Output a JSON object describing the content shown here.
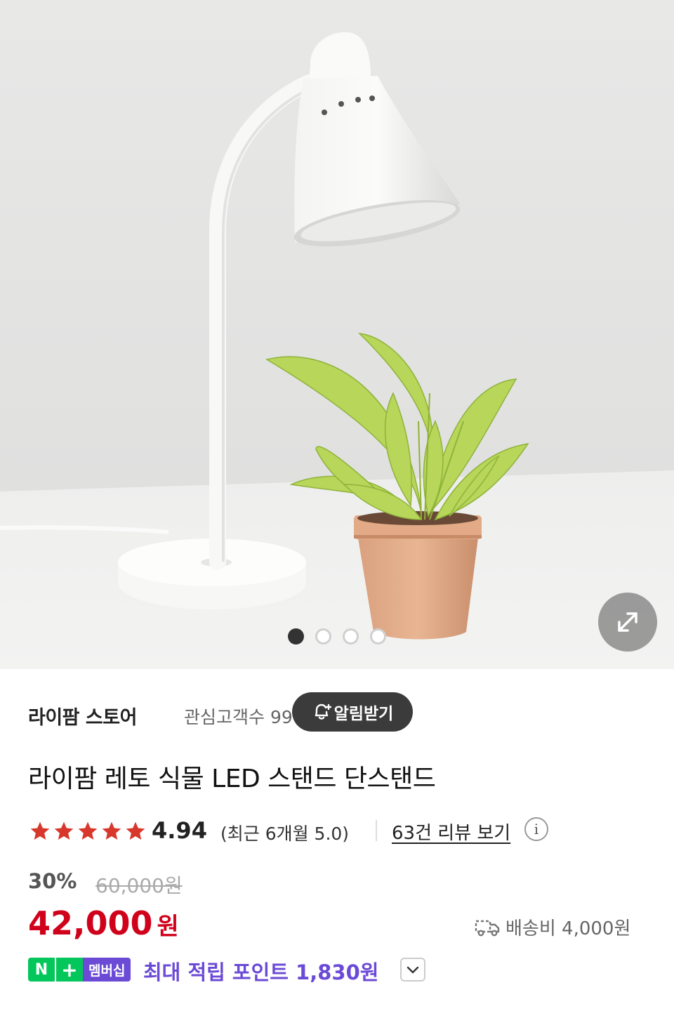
{
  "gallery": {
    "image_alt": "product-photo-lamp-with-plant",
    "total_slides": 4,
    "active_slide": 1,
    "expand_icon": "expand-arrows-icon"
  },
  "store": {
    "name": "라이팜 스토어",
    "followers_label": "관심고객수 99",
    "follow_button_label": "알림받기",
    "follow_icon": "bell-plus-icon"
  },
  "product": {
    "title": "라이팜 레토 식물 LED 스탠드 단스탠드"
  },
  "rating": {
    "stars": 5,
    "value": "4.94",
    "recent_label": "(최근 6개월 5.0)",
    "review_link_label": "63건 리뷰 보기",
    "info_icon": "info-icon",
    "star_color": "#d8382c"
  },
  "pricing": {
    "discount": "30%",
    "original_price": "60,000원",
    "price": "42,000",
    "price_unit": "원",
    "price_color": "#d0011b",
    "shipping_label": "배송비 4,000원",
    "shipping_icon": "truck-icon"
  },
  "membership": {
    "badge_n": "N",
    "badge_plus": "+",
    "badge_label": "멤버십",
    "points_label": "최대 적립 포인트 1,830원",
    "accent_color": "#6b4ad6",
    "toggle_icon": "chevron-down-icon"
  }
}
